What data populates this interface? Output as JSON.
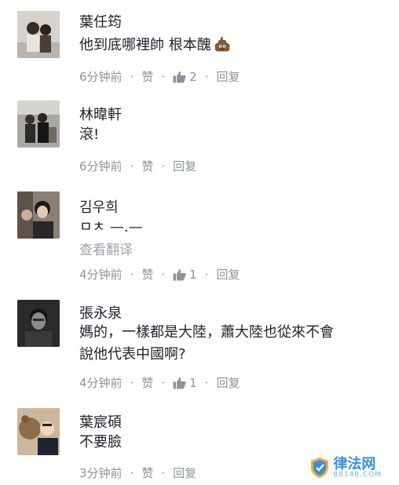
{
  "comments": [
    {
      "name": "葉任筠",
      "text": "他到底哪裡帥 根本醜",
      "emoji": "poop-emoji",
      "time": "6分钟前",
      "like": "赞",
      "like_count": "2",
      "reply": "回复"
    },
    {
      "name": "林暐軒",
      "text": "滾!",
      "time": "6分钟前",
      "like": "赞",
      "reply": "回复"
    },
    {
      "name": "김우희",
      "text": "ㅁㅊ —.—",
      "translate": "查看翻译",
      "time": "4分钟前",
      "like": "赞",
      "like_count": "1",
      "reply": "回复"
    },
    {
      "name": "張永泉",
      "text_line1": "媽的，一樣都是大陸，蕭大陸也從來不會",
      "text_line2": "說他代表中國啊?",
      "time": "4分钟前",
      "like": "赞",
      "like_count": "1",
      "reply": "回复"
    },
    {
      "name": "葉宸碩",
      "text": "不要臉",
      "time": "3分钟前",
      "like": "赞",
      "reply": "回复"
    }
  ],
  "watermark": {
    "title": "律法网",
    "url": "88148.COM"
  },
  "icons": {
    "like": "thumbs-up-icon",
    "emoji": "poop-emoji-icon"
  },
  "colors": {
    "meta": "#8d949e",
    "watermark": "#3a8fd8"
  }
}
